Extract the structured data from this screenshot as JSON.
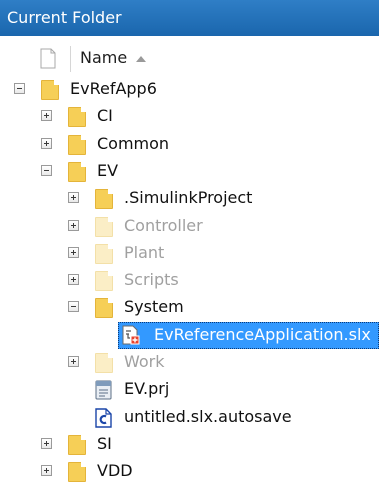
{
  "panel": {
    "title": "Current Folder"
  },
  "header": {
    "name_label": "Name",
    "sort_direction": "ascending"
  },
  "tree": [
    {
      "label": "EvRefApp6",
      "icon": "folder-icon",
      "toggle": "minus",
      "faded": false,
      "level": 0
    },
    {
      "label": "CI",
      "icon": "folder-icon",
      "toggle": "plus",
      "faded": false,
      "level": 1
    },
    {
      "label": "Common",
      "icon": "folder-icon",
      "toggle": "plus",
      "faded": false,
      "level": 1
    },
    {
      "label": "EV",
      "icon": "folder-icon",
      "toggle": "minus",
      "faded": false,
      "level": 1
    },
    {
      "label": ".SimulinkProject",
      "icon": "folder-icon",
      "toggle": "plus",
      "faded": false,
      "level": 2
    },
    {
      "label": "Controller",
      "icon": "folder-icon",
      "toggle": "plus",
      "faded": true,
      "level": 2
    },
    {
      "label": "Plant",
      "icon": "folder-icon",
      "toggle": "plus",
      "faded": true,
      "level": 2
    },
    {
      "label": "Scripts",
      "icon": "folder-icon",
      "toggle": "plus",
      "faded": true,
      "level": 2
    },
    {
      "label": "System",
      "icon": "folder-icon",
      "toggle": "minus",
      "faded": false,
      "level": 2
    },
    {
      "label": "EvReferenceApplication.slx",
      "icon": "simulink-model-icon",
      "toggle": "none",
      "faded": false,
      "level": 3,
      "selected": true
    },
    {
      "label": "Work",
      "icon": "folder-icon",
      "toggle": "plus",
      "faded": true,
      "level": 2
    },
    {
      "label": "EV.prj",
      "icon": "project-file-icon",
      "toggle": "none",
      "faded": false,
      "level": 2
    },
    {
      "label": "untitled.slx.autosave",
      "icon": "autosave-file-icon",
      "toggle": "none",
      "faded": false,
      "level": 2
    },
    {
      "label": "SI",
      "icon": "folder-icon",
      "toggle": "plus",
      "faded": false,
      "level": 1
    },
    {
      "label": "VDD",
      "icon": "folder-icon",
      "toggle": "plus",
      "faded": false,
      "level": 1
    }
  ],
  "colors": {
    "title_bar": "#1a66ad",
    "selection": "#3399ff",
    "folder": "#f6cf57",
    "folder_faded": "#fbeec6"
  }
}
